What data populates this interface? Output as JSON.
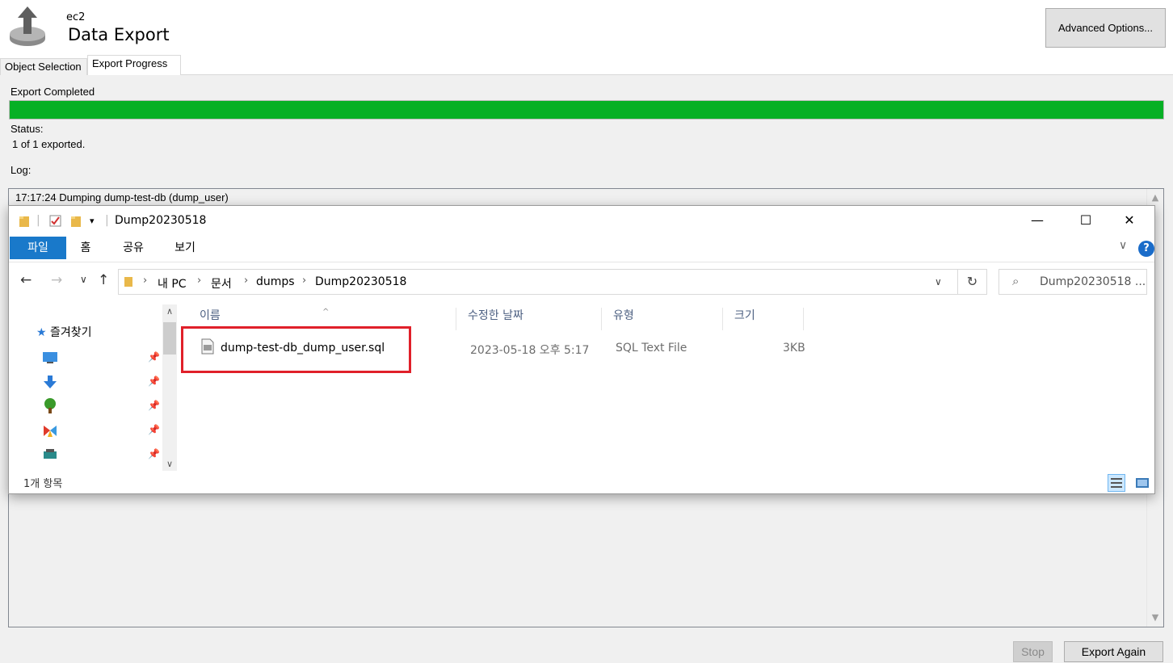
{
  "header": {
    "subtitle": "ec2",
    "title": "Data Export",
    "advanced_label": "Advanced Options..."
  },
  "tabs": [
    {
      "label": "Object Selection"
    },
    {
      "label": "Export Progress"
    }
  ],
  "progress": {
    "heading": "Export Completed",
    "percent": 100,
    "status_label": "Status:",
    "status_value": "1 of 1 exported.",
    "log_label": "Log:"
  },
  "log": {
    "line": "17:17:24 Dumping dump-test-db (dump_user)"
  },
  "footer": {
    "stop_label": "Stop",
    "export_again_label": "Export Again"
  },
  "explorer": {
    "title": "Dump20230518",
    "ribbon": [
      "파일",
      "홈",
      "공유",
      "보기"
    ],
    "breadcrumb": [
      "내 PC",
      "문서",
      "dumps",
      "Dump20230518"
    ],
    "search_placeholder": "Dump20230518 ...",
    "nav": {
      "favorites_label": "즐겨찾기"
    },
    "columns": [
      "이름",
      "수정한 날짜",
      "유형",
      "크기"
    ],
    "files": [
      {
        "name": "dump-test-db_dump_user.sql",
        "modified": "2023-05-18 오후 5:17",
        "type": "SQL Text File",
        "size": "3KB"
      }
    ],
    "status": "1개 항목",
    "colors": {
      "accent": "#1979ca",
      "highlight": "#e0202a"
    }
  }
}
